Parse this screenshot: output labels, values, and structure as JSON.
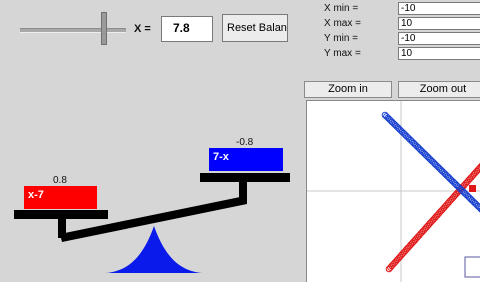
{
  "slider": {
    "value_fraction": 0.8
  },
  "x_input": {
    "label": "X =",
    "value": "7.8"
  },
  "reset_button": {
    "label": "Reset Balanc"
  },
  "axes": [
    {
      "label": "X min =",
      "value": "-10"
    },
    {
      "label": "X max =",
      "value": "10"
    },
    {
      "label": "Y min =",
      "value": "-10"
    },
    {
      "label": "Y max =",
      "value": "10"
    }
  ],
  "zoom_in": {
    "label": "Zoom in"
  },
  "zoom_out": {
    "label": "Zoom out"
  },
  "left_pan": {
    "expression": "x-7",
    "value": "0.8",
    "color": "#ff0000"
  },
  "right_pan": {
    "expression": "7-x",
    "value": "-0.8",
    "color": "#0000ff"
  },
  "fulcrum": {
    "color": "#0a1aeb"
  },
  "graph": {
    "red_series_color": "#e01818",
    "blue_series_color": "#1840d0",
    "red_line": {
      "expression": "x-7"
    },
    "blue_line": {
      "expression": "7-x"
    }
  }
}
